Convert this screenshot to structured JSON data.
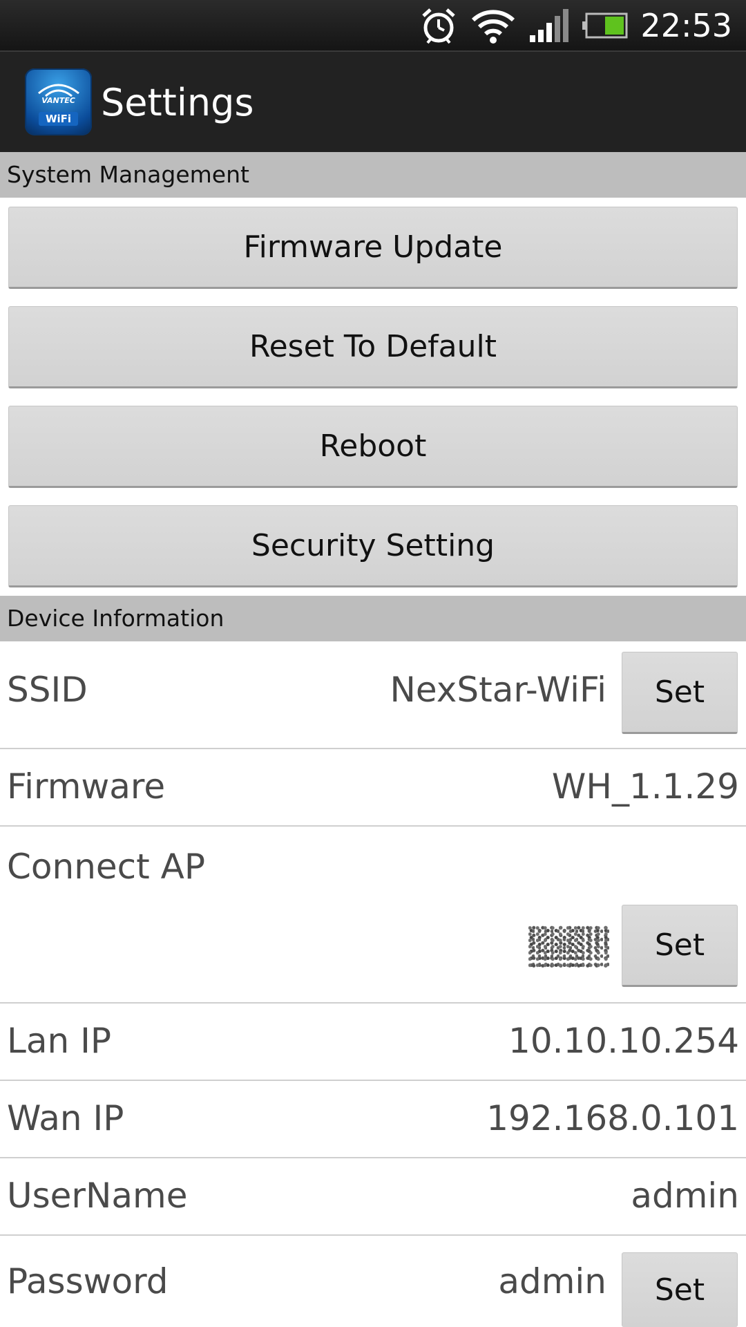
{
  "status_bar": {
    "time": "22:53",
    "icons": [
      "alarm-clock-icon",
      "wifi-icon",
      "cell-signal-icon",
      "battery-icon"
    ],
    "battery_color": "#5fc21e"
  },
  "app_bar": {
    "title": "Settings",
    "app_icon": {
      "brand": "VANTEC",
      "badge": "WiFi"
    }
  },
  "system_management": {
    "header": "System Management",
    "buttons": [
      {
        "label": "Firmware Update"
      },
      {
        "label": "Reset To Default"
      },
      {
        "label": "Reboot"
      },
      {
        "label": "Security Setting"
      }
    ]
  },
  "device_information": {
    "header": "Device Information",
    "rows": {
      "ssid": {
        "label": "SSID",
        "value": "NexStar-WiFi",
        "button": "Set"
      },
      "firmware": {
        "label": "Firmware",
        "value": "WH_1.1.29"
      },
      "connect_ap": {
        "label": "Connect AP",
        "button": "Set"
      },
      "lan_ip": {
        "label": "Lan IP",
        "value": "10.10.10.254"
      },
      "wan_ip": {
        "label": "Wan IP",
        "value": "192.168.0.101"
      },
      "username": {
        "label": "UserName",
        "value": "admin"
      },
      "password": {
        "label": "Password",
        "value": "admin",
        "button": "Set"
      }
    }
  },
  "colors": {
    "section_header_bg": "#bdbdbd",
    "button_bg": "#d7d7d7",
    "action_bar_bg": "#222222",
    "text_muted": "#4a4a4a"
  }
}
